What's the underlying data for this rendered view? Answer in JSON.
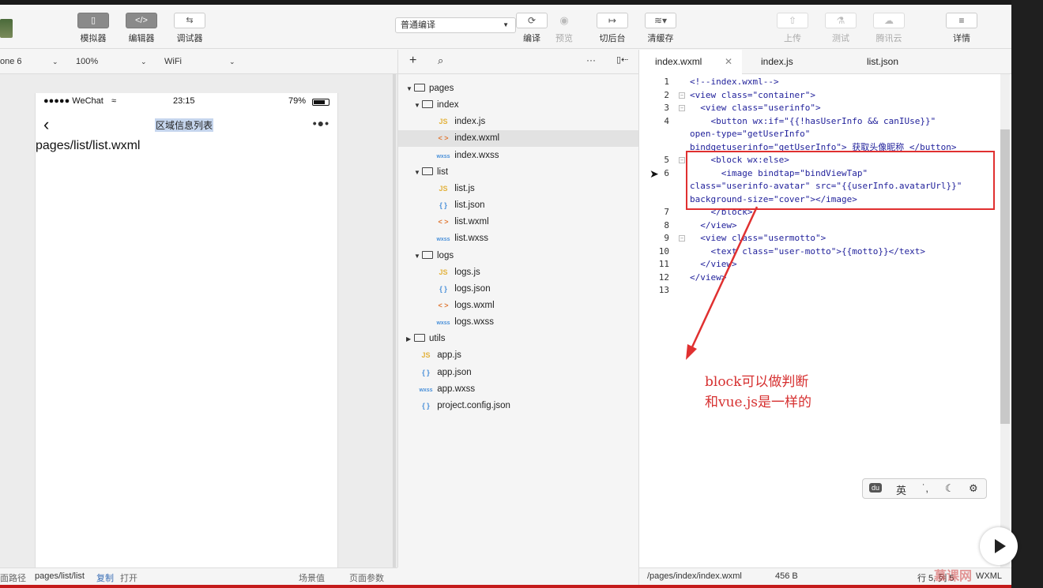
{
  "toolbar": {
    "simulator_label": "模拟器",
    "simulator_icon": "▯",
    "editor_label": "编辑器",
    "editor_icon": "</>",
    "debugger_label": "调试器",
    "debugger_icon": "⇆",
    "compile_mode": "普通编译",
    "compile_label": "编译",
    "preview_label": "预览",
    "background_label": "切后台",
    "clear_cache_label": "清缓存",
    "upload_label": "上传",
    "test_label": "测试",
    "tencent_cloud_label": "腾讯云",
    "details_label": "详情"
  },
  "simulator": {
    "device": "one 6",
    "zoom": "100%",
    "network": "WiFi",
    "status_carrier": "●●●●● WeChat",
    "status_time": "23:15",
    "status_battery": "79%",
    "nav_title": "区域信息列表",
    "page_text": "pages/list/list.wxml"
  },
  "sim_footer": {
    "path_label": "面路径",
    "path": "pages/list/list",
    "copy": "复制",
    "open": "打开",
    "scene_label": "场景值",
    "params_label": "页面参数"
  },
  "file_tree": [
    {
      "name": "pages",
      "type": "folder",
      "open": true
    },
    {
      "name": "index",
      "type": "folder",
      "open": true
    },
    {
      "name": "index.js",
      "type": "js"
    },
    {
      "name": "index.wxml",
      "type": "wxml",
      "selected": true
    },
    {
      "name": "index.wxss",
      "type": "wxss"
    },
    {
      "name": "list",
      "type": "folder",
      "open": true
    },
    {
      "name": "list.js",
      "type": "js"
    },
    {
      "name": "list.json",
      "type": "json"
    },
    {
      "name": "list.wxml",
      "type": "wxml"
    },
    {
      "name": "list.wxss",
      "type": "wxss"
    },
    {
      "name": "logs",
      "type": "folder",
      "open": true
    },
    {
      "name": "logs.js",
      "type": "js"
    },
    {
      "name": "logs.json",
      "type": "json"
    },
    {
      "name": "logs.wxml",
      "type": "wxml"
    },
    {
      "name": "logs.wxss",
      "type": "wxss"
    },
    {
      "name": "utils",
      "type": "folder",
      "open": false
    },
    {
      "name": "app.js",
      "type": "js"
    },
    {
      "name": "app.json",
      "type": "json"
    },
    {
      "name": "app.wxss",
      "type": "wxss"
    },
    {
      "name": "project.config.json",
      "type": "json"
    }
  ],
  "file_icons": {
    "js": "JS",
    "json": "{ }",
    "wxml": "< >",
    "wxss": "wxss"
  },
  "tabs": [
    "index.wxml",
    "index.js",
    "list.json"
  ],
  "code_lines": [
    {
      "n": "1",
      "text": "<!--index.wxml-->"
    },
    {
      "n": "2",
      "text": "<view class=\"container\">"
    },
    {
      "n": "3",
      "text": "  <view class=\"userinfo\">"
    },
    {
      "n": "4",
      "text": "    <button wx:if=\"{{!hasUserInfo && canIUse}}\""
    },
    {
      "n": "",
      "text": "open-type=\"getUserInfo\""
    },
    {
      "n": "",
      "text": "bindgetuserinfo=\"getUserInfo\"> 获取头像昵称 </button>"
    },
    {
      "n": "5",
      "text": "    <block wx:else>"
    },
    {
      "n": "6",
      "text": "      <image bindtap=\"bindViewTap\""
    },
    {
      "n": "",
      "text": "class=\"userinfo-avatar\" src=\"{{userInfo.avatarUrl}}\""
    },
    {
      "n": "",
      "text": "background-size=\"cover\"></image>"
    },
    {
      "n": "7",
      "text": "    </block>"
    },
    {
      "n": "8",
      "text": "  </view>"
    },
    {
      "n": "9",
      "text": "  <view class=\"usermotto\">"
    },
    {
      "n": "10",
      "text": "    <text class=\"user-motto\">{{motto}}</text>"
    },
    {
      "n": "11",
      "text": "  </view>"
    },
    {
      "n": "12",
      "text": "</view>"
    },
    {
      "n": "13",
      "text": ""
    }
  ],
  "annotation": {
    "line1": "block可以做判断",
    "line2": "和vue.js是一样的"
  },
  "ime": {
    "logo": "du",
    "lang": "英",
    "punct": "˙,",
    "moon": "☾",
    "gear": "⚙"
  },
  "editor_footer": {
    "path": "/pages/index/index.wxml",
    "size": "456 B",
    "position": "行 5, 列 5",
    "lang": "WXML"
  },
  "watermark": "慕课网",
  "colors": {
    "annotation": "#d63030",
    "selection": "#c6d6ee",
    "accent": "#3b6fb6"
  }
}
